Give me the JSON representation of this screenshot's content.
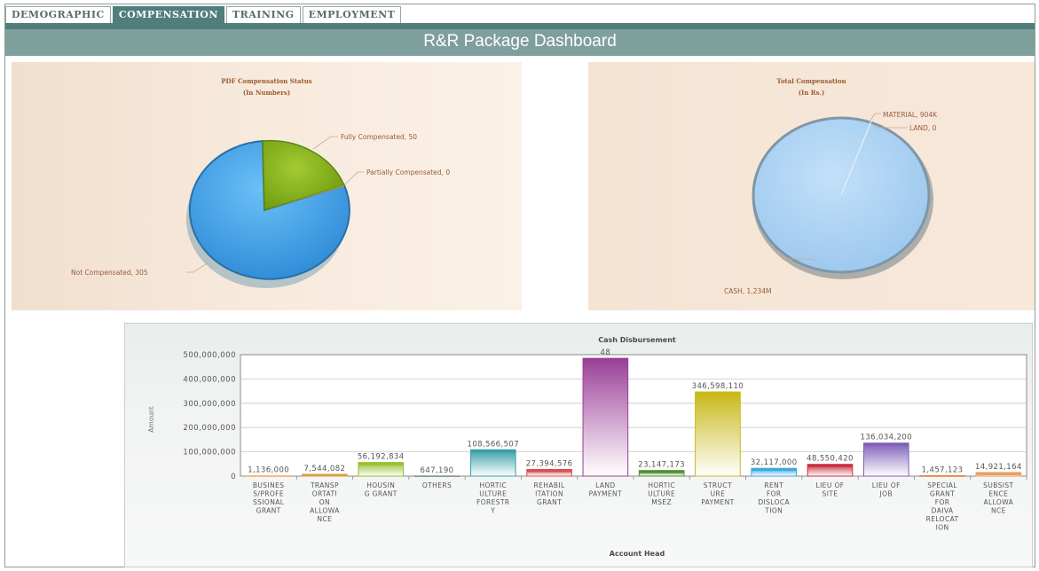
{
  "tabs": [
    {
      "label": "DEMOGRAPHIC",
      "active": false
    },
    {
      "label": "COMPENSATION",
      "active": true
    },
    {
      "label": "TRAINING",
      "active": false
    },
    {
      "label": "EMPLOYMENT",
      "active": false
    }
  ],
  "dashboard_title": "R&R Package Dashboard",
  "colors": {
    "tab_active": "#4f7e7c",
    "title_bar": "#7f9f9d"
  },
  "pdf_status": {
    "title_line1": "PDF Compensation Status",
    "title_line2": "(In Numbers)",
    "slices": [
      {
        "label": "Fully Compensated, 50",
        "value": 50,
        "color": "#8cb520"
      },
      {
        "label": "Partially Compensated, 0",
        "value": 0,
        "color": "#e0a030"
      },
      {
        "label": "Not Compensated, 305",
        "value": 305,
        "color": "#48a6ea"
      }
    ]
  },
  "total_comp": {
    "title_line1": "Total Compensation",
    "title_line2": "(In Rs.)",
    "slices": [
      {
        "label": "MATERIAL, 904K",
        "value": 0.904,
        "color": "#f0f0f0"
      },
      {
        "label": "LAND, 0",
        "value": 0,
        "color": "#e0a030"
      },
      {
        "label": "CASH, 1,234M",
        "value": 1234,
        "color": "#b3d5f3"
      }
    ]
  },
  "chart_data": {
    "type": "bar",
    "title": "Cash Disbursement",
    "xlabel": "Account Head",
    "ylabel": "Amount",
    "ylim": [
      0,
      500000000
    ],
    "yticks": [
      "0",
      "100,000,000",
      "200,000,000",
      "300,000,000",
      "400,000,000",
      "500,000,000"
    ],
    "categories": [
      [
        "BUSINES",
        "S/PROFE",
        "SSIONAL",
        "GRANT"
      ],
      [
        "TRANSP",
        "ORTATI",
        "ON",
        "ALLOWA",
        "NCE"
      ],
      [
        "HOUSIN",
        "G GRANT"
      ],
      [
        "OTHERS"
      ],
      [
        "HORTIC",
        "ULTURE",
        "FORESTR",
        "Y"
      ],
      [
        "REHABIL",
        "ITATION",
        "GRANT"
      ],
      [
        "LAND",
        "PAYMENT"
      ],
      [
        "HORTIC",
        "ULTURE",
        "MSEZ"
      ],
      [
        "STRUCT",
        "URE",
        "PAYMENT"
      ],
      [
        "RENT",
        "FOR",
        "DISLOCA",
        "TION"
      ],
      [
        "LIEU OF",
        "SITE"
      ],
      [
        "LIEU OF",
        "JOB"
      ],
      [
        "SPECIAL",
        "GRANT",
        "FOR",
        "DAIVA",
        "RELOCAT",
        "ION"
      ],
      [
        "SUBSIST",
        "ENCE",
        "ALLOWA",
        "NCE"
      ]
    ],
    "values": [
      1136000,
      7544082,
      56192834,
      647190,
      108566507,
      27394576,
      485000000,
      23147173,
      346598110,
      32117000,
      48550420,
      136034200,
      1457123,
      14921164
    ],
    "data_labels": [
      "1,136,000",
      "7,544,082",
      "56,192,834",
      "647,190",
      "108,566,507",
      "27,394,576",
      "48",
      "23,147,173",
      "346,598,110",
      "32,117,000",
      "48,550,420",
      "136,034,200",
      "1,457,123",
      "14,921,164"
    ],
    "colors": [
      "#f0b060",
      "#d8a040",
      "#98c030",
      "#7f8f8f",
      "#38a0a8",
      "#d85050",
      "#9a3f96",
      "#4f8f30",
      "#c8b818",
      "#40a8e0",
      "#c83040",
      "#8060b8",
      "#e07830",
      "#e8a060"
    ],
    "grid": true
  }
}
